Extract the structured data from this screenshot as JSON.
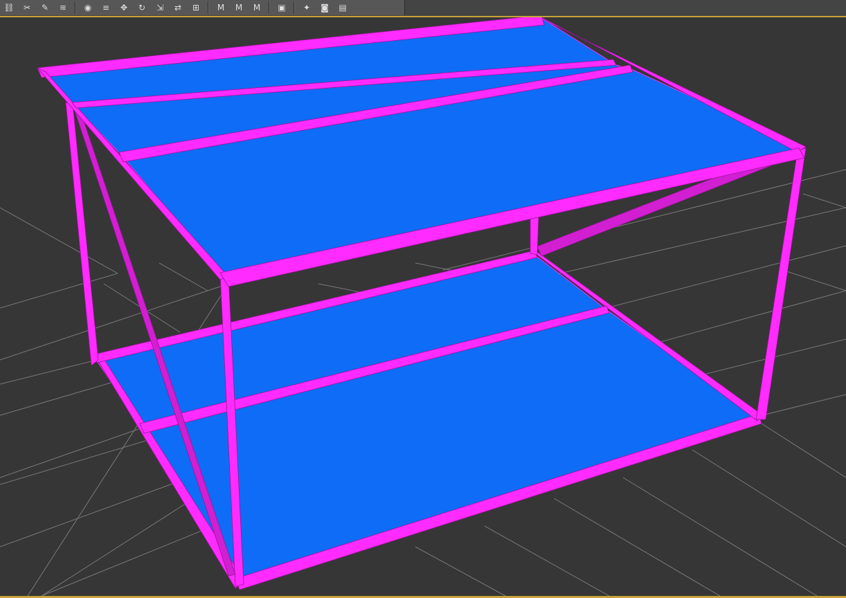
{
  "toolbar": {
    "buttons": [
      {
        "icon": "link-icon",
        "glyph": "⛓"
      },
      {
        "icon": "unlink-icon",
        "glyph": "✂"
      },
      {
        "icon": "bind-icon",
        "glyph": "✎"
      },
      {
        "icon": "wave-icon",
        "glyph": "≋"
      },
      {
        "icon": "select-object-icon",
        "glyph": "◉"
      },
      {
        "icon": "select-by-name-icon",
        "glyph": "≡"
      },
      {
        "icon": "move-icon",
        "glyph": "✥"
      },
      {
        "icon": "rotate-icon",
        "glyph": "↻"
      },
      {
        "icon": "scale-icon",
        "glyph": "⇲"
      },
      {
        "icon": "mirror-icon",
        "glyph": "⇄"
      },
      {
        "icon": "align-icon",
        "glyph": "⊞"
      },
      {
        "icon": "material-editor-icon",
        "glyph": "M"
      },
      {
        "icon": "material-map-icon",
        "glyph": "M"
      },
      {
        "icon": "render-setup-icon",
        "glyph": "M"
      },
      {
        "icon": "rendered-frame-icon",
        "glyph": "▣"
      },
      {
        "icon": "render-production-icon",
        "glyph": "✦"
      },
      {
        "icon": "render-camera-icon",
        "glyph": "◙"
      },
      {
        "icon": "render-film-icon",
        "glyph": "▤"
      }
    ]
  },
  "viewport": {
    "background_color": "#363636",
    "grid_color": "#7a7a7a",
    "frame_color": "#ff2bff",
    "frame_edge_color": "#9a149a",
    "panel_color": "#0f6cf6",
    "accent_color": "#c8a23a"
  }
}
